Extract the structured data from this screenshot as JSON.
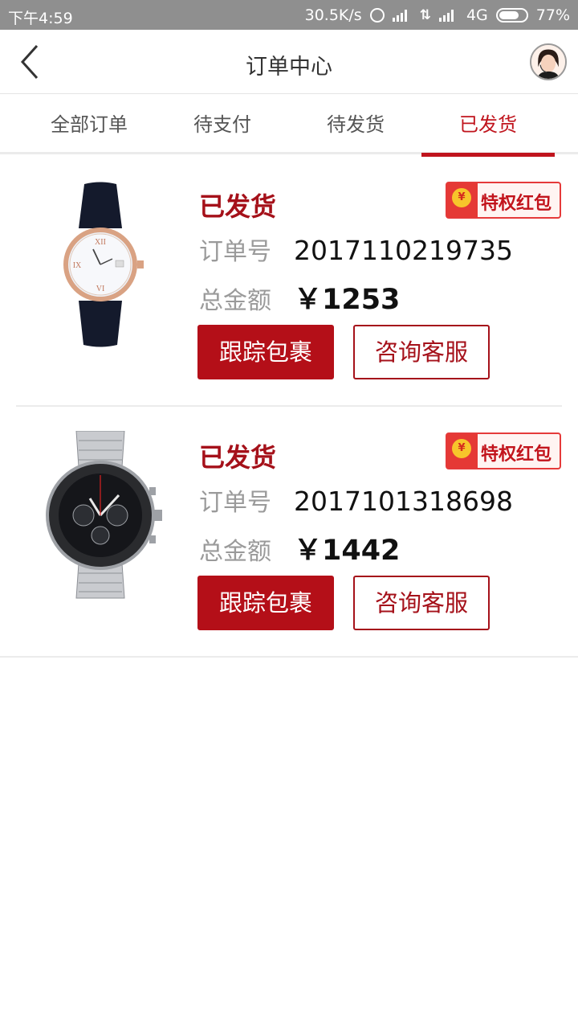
{
  "status_bar": {
    "time": "下午4:59",
    "net_speed": "30.5K/s",
    "network_type": "4G",
    "battery": "77%",
    "battery_level": 0.77
  },
  "header": {
    "title": "订单中心",
    "back_icon": "chevron-left-icon",
    "avatar_icon": "customer-service-avatar"
  },
  "tabs": [
    {
      "label": "全部订单",
      "active": false
    },
    {
      "label": "待支付",
      "active": false
    },
    {
      "label": "待发货",
      "active": false
    },
    {
      "label": "已发货",
      "active": true
    }
  ],
  "orders": [
    {
      "status": "已发货",
      "badge": "特权红包",
      "badge_coin": "¥",
      "order_no_label": "订单号",
      "order_no": "2017110219735",
      "amount_label": "总金额",
      "amount": "￥1253",
      "track_button": "跟踪包裹",
      "service_button": "咨询客服",
      "image": "women-watch-leather-strap"
    },
    {
      "status": "已发货",
      "badge": "特权红包",
      "badge_coin": "¥",
      "order_no_label": "订单号",
      "order_no": "2017101318698",
      "amount_label": "总金额",
      "amount": "￥1442",
      "track_button": "跟踪包裹",
      "service_button": "咨询客服",
      "image": "men-chronograph-steel-watch"
    }
  ],
  "colors": {
    "accent": "#a5111a",
    "status_bar": "#8f8f8f"
  }
}
